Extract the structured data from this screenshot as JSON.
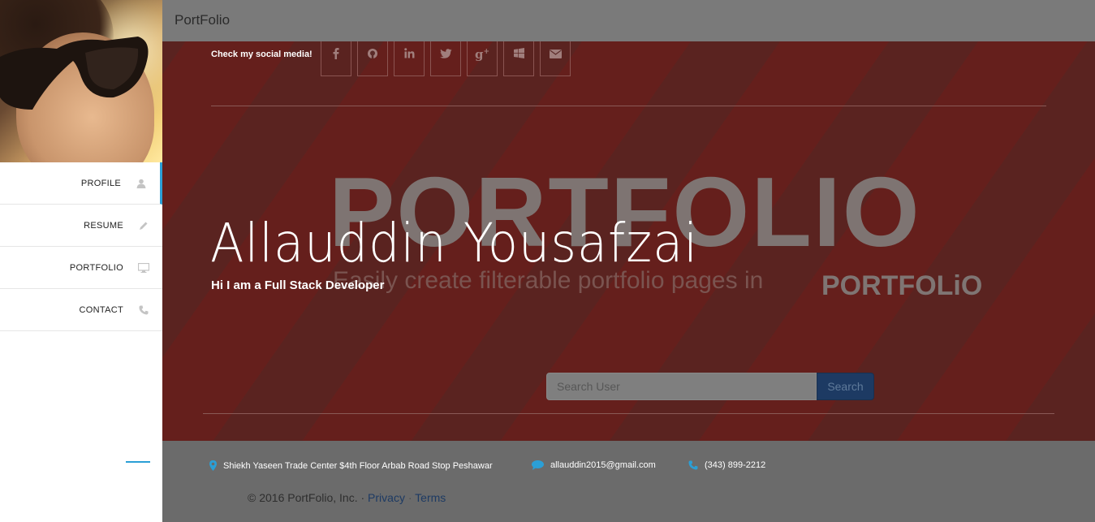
{
  "app": {
    "brand": "PortFolio"
  },
  "sidebar": {
    "items": [
      {
        "label": "PROFILE",
        "icon": "user-icon",
        "active": true
      },
      {
        "label": "RESUME",
        "icon": "pencil-icon",
        "active": false
      },
      {
        "label": "PORTFOLIO",
        "icon": "desktop-icon",
        "active": false
      },
      {
        "label": "CONTACT",
        "icon": "phone-icon",
        "active": false
      }
    ]
  },
  "hero": {
    "social_text": "Check my social media!",
    "social_icons": [
      "facebook-icon",
      "github-icon",
      "linkedin-icon",
      "twitter-icon",
      "google-plus-icon",
      "windows-icon",
      "envelope-icon"
    ],
    "background_word": "PORTFOLIO",
    "background_sub": "Easily create filterable portfolio pages in",
    "background_logo": "PORTFOLiO",
    "name": "Allauddin Yousafzai",
    "tagline": "Hi I am a Full Stack Developer",
    "search": {
      "placeholder": "Search User",
      "button": "Search"
    }
  },
  "footer": {
    "address": "Shiekh Yaseen Trade Center $4th Floor Arbab Road Stop Peshawar",
    "email": "allauddin2015@gmail.com",
    "phone": "(343) 899-2212",
    "copyright": "© 2016 PortFolio, Inc. ·",
    "privacy": "Privacy",
    "sep": "·",
    "terms": "Terms"
  },
  "colors": {
    "accent": "#2b9fd6",
    "hero_bg": "#5a2320",
    "button": "#1d3a63"
  }
}
